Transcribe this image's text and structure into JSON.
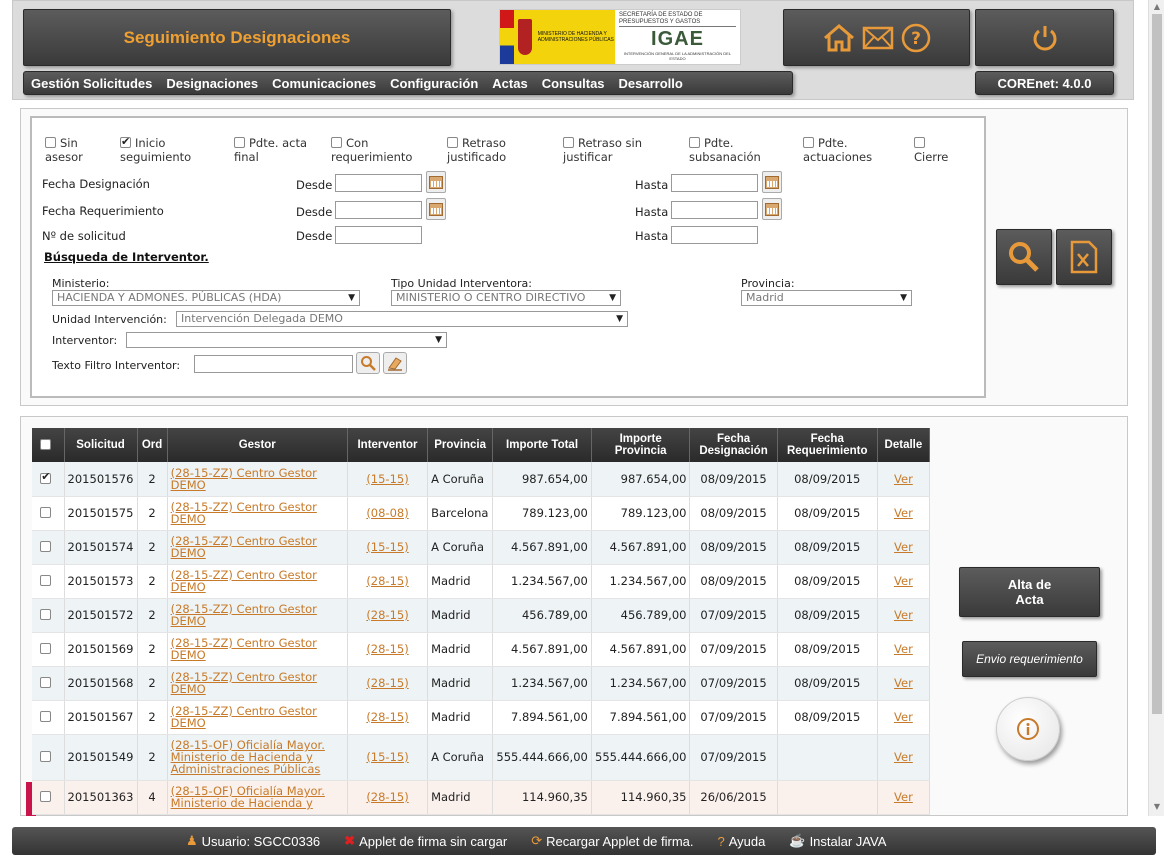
{
  "header": {
    "title": "Seguimiento Designaciones",
    "logo": {
      "left_text": "MINISTERIO DE HACIENDA Y ADMINISTRACIONES PÚBLICAS",
      "sec_text": "SECRETARÍA DE ESTADO DE PRESUPUESTOS Y GASTOS",
      "brand": "IGAE",
      "sub_text": "INTERVENCIÓN GENERAL DE LA ADMINISTRACIÓN DEL ESTADO"
    },
    "icons": [
      "home-icon",
      "mail-icon",
      "help-icon"
    ],
    "power_icon": "power-icon",
    "menu": [
      "Gestión Solicitudes",
      "Designaciones",
      "Comunicaciones",
      "Configuración",
      "Actas",
      "Consultas",
      "Desarrollo"
    ],
    "version": "COREnet: 4.0.0"
  },
  "filters": {
    "checkboxes": [
      {
        "line1": "Sin",
        "line2": "asesor",
        "checked": false
      },
      {
        "line1": "Inicio",
        "line2": "seguimiento",
        "checked": true
      },
      {
        "line1": "Pdte. acta",
        "line2": "final",
        "checked": false
      },
      {
        "line1": "Con",
        "line2": "requerimiento",
        "checked": false
      },
      {
        "line1": "Retraso",
        "line2": "justificado",
        "checked": false
      },
      {
        "line1": "Retraso sin",
        "line2": "justificar",
        "checked": false
      },
      {
        "line1": "Pdte.",
        "line2": "subsanación",
        "checked": false
      },
      {
        "line1": "Pdte.",
        "line2": "actuaciones",
        "checked": false
      },
      {
        "line1": "",
        "line2": "Cierre",
        "checked": false
      }
    ],
    "fecha_designacion": "Fecha Designación",
    "fecha_requerimiento": "Fecha Requerimiento",
    "num_solicitud": "Nº de solicitud",
    "desde": "Desde",
    "hasta": "Hasta",
    "busqueda_title": "Búsqueda de Interventor.",
    "ministerio_label": "Ministerio:",
    "ministerio_value": "HACIENDA Y ADMONES. PÚBLICAS (HDA)",
    "tipo_unidad_label": "Tipo Unidad Interventora:",
    "tipo_unidad_value": "MINISTERIO O CENTRO DIRECTIVO",
    "provincia_label": "Provincia:",
    "provincia_value": "Madrid",
    "unidad_label": "Unidad Intervención:",
    "unidad_value": "Intervención Delegada DEMO",
    "interventor_label": "Interventor:",
    "interventor_value": "",
    "texto_filtro_label": "Texto Filtro Interventor:",
    "texto_filtro_value": ""
  },
  "table": {
    "headers": [
      "",
      "Solicitud",
      "Ord",
      "Gestor",
      "Interventor",
      "Provincia",
      "Importe Total",
      "Importe Provincia",
      "Fecha Designación",
      "Fecha Requerimiento",
      "Detalle"
    ],
    "rows": [
      {
        "checked": true,
        "solicitud": "201501576",
        "ord": "2",
        "gestor": "(28-15-ZZ) Centro Gestor DEMO",
        "interventor": "(15-15)",
        "provincia": "A Coruña",
        "importe_total": "987.654,00",
        "importe_provincia": "987.654,00",
        "fecha_designacion": "08/09/2015",
        "fecha_requerimiento": "08/09/2015",
        "detalle": "Ver"
      },
      {
        "checked": false,
        "solicitud": "201501575",
        "ord": "2",
        "gestor": "(28-15-ZZ) Centro Gestor DEMO",
        "interventor": "(08-08)",
        "provincia": "Barcelona",
        "importe_total": "789.123,00",
        "importe_provincia": "789.123,00",
        "fecha_designacion": "08/09/2015",
        "fecha_requerimiento": "08/09/2015",
        "detalle": "Ver"
      },
      {
        "checked": false,
        "solicitud": "201501574",
        "ord": "2",
        "gestor": "(28-15-ZZ) Centro Gestor DEMO",
        "interventor": "(15-15)",
        "provincia": "A Coruña",
        "importe_total": "4.567.891,00",
        "importe_provincia": "4.567.891,00",
        "fecha_designacion": "08/09/2015",
        "fecha_requerimiento": "08/09/2015",
        "detalle": "Ver"
      },
      {
        "checked": false,
        "solicitud": "201501573",
        "ord": "2",
        "gestor": "(28-15-ZZ) Centro Gestor DEMO",
        "interventor": "(28-15)",
        "provincia": "Madrid",
        "importe_total": "1.234.567,00",
        "importe_provincia": "1.234.567,00",
        "fecha_designacion": "08/09/2015",
        "fecha_requerimiento": "08/09/2015",
        "detalle": "Ver"
      },
      {
        "checked": false,
        "solicitud": "201501572",
        "ord": "2",
        "gestor": "(28-15-ZZ) Centro Gestor DEMO",
        "interventor": "(28-15)",
        "provincia": "Madrid",
        "importe_total": "456.789,00",
        "importe_provincia": "456.789,00",
        "fecha_designacion": "07/09/2015",
        "fecha_requerimiento": "08/09/2015",
        "detalle": "Ver"
      },
      {
        "checked": false,
        "solicitud": "201501569",
        "ord": "2",
        "gestor": "(28-15-ZZ) Centro Gestor DEMO",
        "interventor": "(28-15)",
        "provincia": "Madrid",
        "importe_total": "4.567.891,00",
        "importe_provincia": "4.567.891,00",
        "fecha_designacion": "07/09/2015",
        "fecha_requerimiento": "08/09/2015",
        "detalle": "Ver"
      },
      {
        "checked": false,
        "solicitud": "201501568",
        "ord": "2",
        "gestor": "(28-15-ZZ) Centro Gestor DEMO",
        "interventor": "(28-15)",
        "provincia": "Madrid",
        "importe_total": "1.234.567,00",
        "importe_provincia": "1.234.567,00",
        "fecha_designacion": "07/09/2015",
        "fecha_requerimiento": "08/09/2015",
        "detalle": "Ver"
      },
      {
        "checked": false,
        "solicitud": "201501567",
        "ord": "2",
        "gestor": "(28-15-ZZ) Centro Gestor DEMO",
        "interventor": "(28-15)",
        "provincia": "Madrid",
        "importe_total": "7.894.561,00",
        "importe_provincia": "7.894.561,00",
        "fecha_designacion": "07/09/2015",
        "fecha_requerimiento": "08/09/2015",
        "detalle": "Ver"
      },
      {
        "checked": false,
        "solicitud": "201501549",
        "ord": "2",
        "gestor": "(28-15-OF) Oficialía Mayor. Ministerio de Hacienda y Administraciones Públicas",
        "interventor": "(15-15)",
        "provincia": "A Coruña",
        "importe_total": "555.444.666,00",
        "importe_provincia": "555.444.666,00",
        "fecha_designacion": "07/09/2015",
        "fecha_requerimiento": "",
        "detalle": "Ver"
      },
      {
        "checked": false,
        "solicitud": "201501363",
        "ord": "4",
        "gestor": "(28-15-OF) Oficialía Mayor. Ministerio de Hacienda y",
        "interventor": "(28-15)",
        "provincia": "Madrid",
        "importe_total": "114.960,35",
        "importe_provincia": "114.960,35",
        "fecha_designacion": "26/06/2015",
        "fecha_requerimiento": "",
        "detalle": "Ver"
      }
    ]
  },
  "actions": {
    "search_icon": "search-icon",
    "excel_icon": "excel-export-icon",
    "alta_acta": "Alta de Acta",
    "envio_requerimiento": "Envio requerimiento",
    "info_icon": "info-icon"
  },
  "footer": {
    "usuario": "Usuario: SGCC0336",
    "applet": "Applet de firma sin cargar",
    "recargar": "Recargar Applet de firma.",
    "ayuda": "Ayuda",
    "instalar": "Instalar JAVA"
  },
  "colors": {
    "accent": "#f0a030",
    "link": "#c77a2a",
    "dark": "#3a3a3a",
    "row_marker": "#c8144a"
  }
}
